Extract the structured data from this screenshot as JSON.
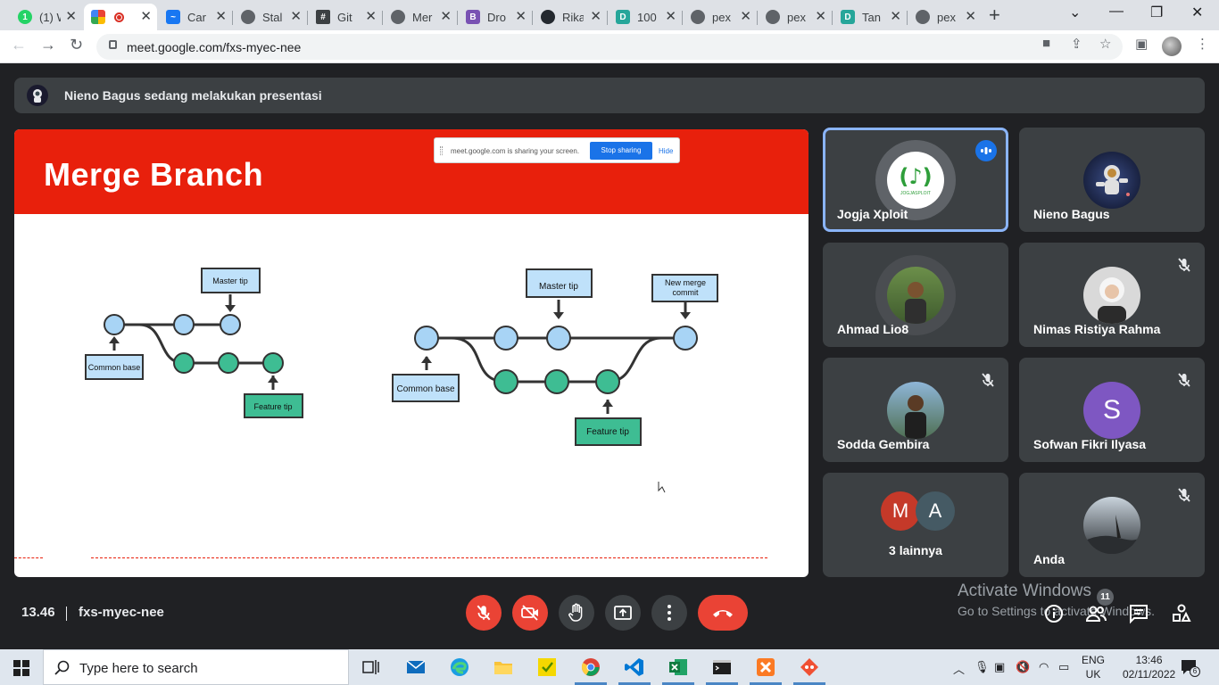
{
  "browser": {
    "tabs": [
      {
        "title": "(1) W",
        "fav": "whatsapp-favicon",
        "color": "#25d366",
        "glyph": "1"
      },
      {
        "title": "",
        "fav": "meet-favicon",
        "color": "#00897b",
        "glyph": ""
      },
      {
        "title": "Car",
        "fav": "messenger-favicon",
        "color": "#1877f2",
        "glyph": "~"
      },
      {
        "title": "Stal",
        "fav": "globe-favicon",
        "color": "#5f6368",
        "glyph": ""
      },
      {
        "title": "Git",
        "fav": "git-favicon",
        "color": "#3c4043",
        "glyph": "#"
      },
      {
        "title": "Mer",
        "fav": "globe-favicon",
        "color": "#5f6368",
        "glyph": ""
      },
      {
        "title": "Dro",
        "fav": "bootstrap-favicon",
        "color": "#7952b3",
        "glyph": "B"
      },
      {
        "title": "Rika",
        "fav": "github-favicon",
        "color": "#24292f",
        "glyph": ""
      },
      {
        "title": "100",
        "fav": "d-favicon",
        "color": "#26a69a",
        "glyph": "D"
      },
      {
        "title": "pex",
        "fav": "globe-favicon",
        "color": "#5f6368",
        "glyph": ""
      },
      {
        "title": "pex",
        "fav": "globe-favicon",
        "color": "#5f6368",
        "glyph": ""
      },
      {
        "title": "Tan",
        "fav": "d-favicon",
        "color": "#26a69a",
        "glyph": "D"
      },
      {
        "title": "pex",
        "fav": "globe-favicon",
        "color": "#5f6368",
        "glyph": ""
      }
    ],
    "url": "meet.google.com/fxs-myec-nee"
  },
  "meet": {
    "presenting_banner": "Nieno Bagus sedang melakukan presentasi",
    "slide": {
      "title": "Merge Branch",
      "share_notice": "meet.google.com is sharing your screen.",
      "stop_sharing": "Stop sharing",
      "hide": "Hide",
      "diagram_left": {
        "master_tip": "Master tip",
        "common_base": "Common base",
        "feature_tip": "Feature tip"
      },
      "diagram_right": {
        "master_tip": "Master tip",
        "new_merge_commit_1": "New merge",
        "new_merge_commit_2": "commit",
        "common_base": "Common base",
        "feature_tip": "Feature tip"
      }
    },
    "participants": [
      {
        "name": "Jogja Xploit",
        "avatar": "logo",
        "speaking": true,
        "muted": false
      },
      {
        "name": "Nieno Bagus",
        "avatar": "astronaut",
        "speaking": false,
        "muted": false
      },
      {
        "name": "Ahmad Lio8",
        "avatar": "photo",
        "speaking": false,
        "muted": false
      },
      {
        "name": "Nimas Ristiya Rahma",
        "avatar": "photo",
        "speaking": false,
        "muted": true
      },
      {
        "name": "Sodda Gembira",
        "avatar": "photo",
        "speaking": false,
        "muted": true
      },
      {
        "name": "Sofwan Fikri Ilyasa",
        "avatar": "S",
        "avatar_color": "#7e57c2",
        "speaking": false,
        "muted": true
      },
      {
        "name": "3 lainnya",
        "avatar": "M A",
        "avatar_colors": [
          "#c53929",
          "#455a64"
        ],
        "speaking": false,
        "muted": false
      },
      {
        "name": "Anda",
        "avatar": "photo",
        "speaking": false,
        "muted": true
      }
    ],
    "others_letters": [
      "M",
      "A"
    ],
    "sofwan_letter": "S",
    "jogja_logo_text": "JOGJASPLOIT",
    "time": "13.46",
    "meeting_code": "fxs-myec-nee",
    "participants_count": "11",
    "activate_windows_1": "Activate Windows",
    "activate_windows_2": "Go to Settings to activate Windows."
  },
  "taskbar": {
    "search_placeholder": "Type here to search",
    "lang_1": "ENG",
    "lang_2": "UK",
    "time": "13:46",
    "date": "02/11/2022",
    "notifications": "6"
  }
}
